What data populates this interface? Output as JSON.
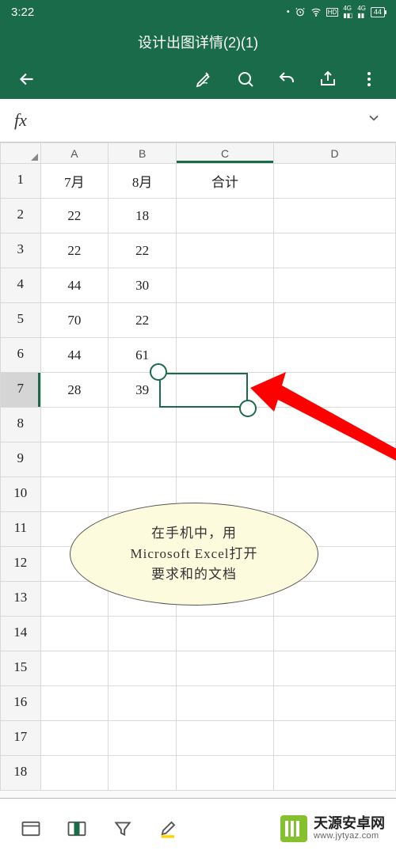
{
  "status": {
    "time": "3:22",
    "battery": "44"
  },
  "header": {
    "title": "设计出图详情(2)(1)"
  },
  "fx": {
    "label": "fx"
  },
  "columns": [
    "A",
    "B",
    "C",
    "D"
  ],
  "row_numbers": [
    "1",
    "2",
    "3",
    "4",
    "5",
    "6",
    "7",
    "8",
    "9",
    "10",
    "11",
    "12",
    "13",
    "14",
    "15",
    "16",
    "17",
    "18"
  ],
  "cells": {
    "A1": "7月",
    "B1": "8月",
    "C1": "合计",
    "A2": "22",
    "B2": "18",
    "A3": "22",
    "B3": "22",
    "A4": "44",
    "B4": "30",
    "A5": "70",
    "B5": "22",
    "A6": "44",
    "B6": "61",
    "A7": "28",
    "B7": "39"
  },
  "selected_cell": "C7",
  "callout": {
    "line1": "在手机中，用",
    "line2": "Microsoft Excel打开",
    "line3": "要求和的文档"
  },
  "watermark": {
    "cn": "天源安卓网",
    "en": "www.jytyaz.com"
  }
}
